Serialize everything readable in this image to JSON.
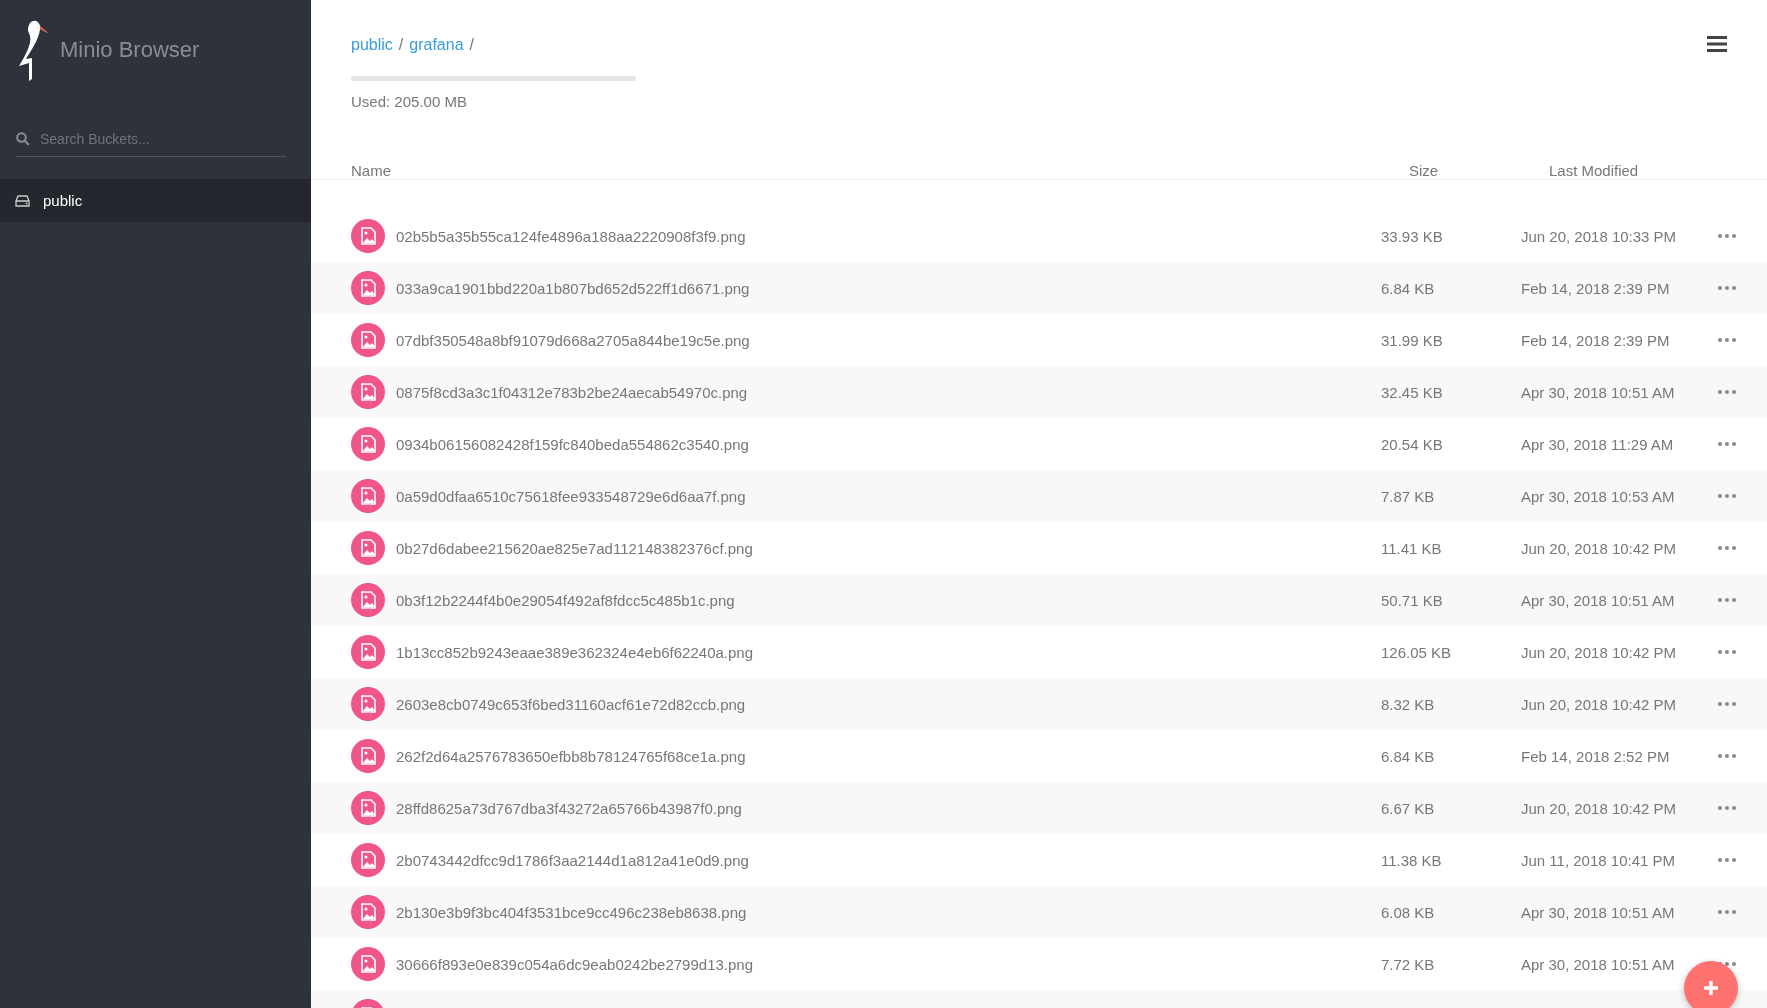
{
  "sidebar": {
    "title": "Minio Browser",
    "search": {
      "placeholder": "Search Buckets..."
    },
    "buckets": [
      {
        "name": "public",
        "selected": true
      }
    ]
  },
  "breadcrumb": [
    {
      "text": "public",
      "separator": "/"
    },
    {
      "text": "grafana",
      "separator": "/"
    }
  ],
  "usage": {
    "text": "Used: 205.00 MB"
  },
  "table": {
    "columns": [
      "Name",
      "Size",
      "Last Modified"
    ],
    "rows": [
      {
        "name": "02b5b5a35b55ca124fe4896a188aa2220908f3f9.png",
        "size": "33.93 KB",
        "modified": "Jun 20, 2018 10:33 PM"
      },
      {
        "name": "033a9ca1901bbd220a1b807bd652d522ff1d6671.png",
        "size": "6.84 KB",
        "modified": "Feb 14, 2018 2:39 PM"
      },
      {
        "name": "07dbf350548a8bf91079d668a2705a844be19c5e.png",
        "size": "31.99 KB",
        "modified": "Feb 14, 2018 2:39 PM"
      },
      {
        "name": "0875f8cd3a3c1f04312e783b2be24aecab54970c.png",
        "size": "32.45 KB",
        "modified": "Apr 30, 2018 10:51 AM"
      },
      {
        "name": "0934b06156082428f159fc840beda554862c3540.png",
        "size": "20.54 KB",
        "modified": "Apr 30, 2018 11:29 AM"
      },
      {
        "name": "0a59d0dfaa6510c75618fee933548729e6d6aa7f.png",
        "size": "7.87 KB",
        "modified": "Apr 30, 2018 10:53 AM"
      },
      {
        "name": "0b27d6dabee215620ae825e7ad112148382376cf.png",
        "size": "11.41 KB",
        "modified": "Jun 20, 2018 10:42 PM"
      },
      {
        "name": "0b3f12b2244f4b0e29054f492af8fdcc5c485b1c.png",
        "size": "50.71 KB",
        "modified": "Apr 30, 2018 10:51 AM"
      },
      {
        "name": "1b13cc852b9243eaae389e362324e4eb6f62240a.png",
        "size": "126.05 KB",
        "modified": "Jun 20, 2018 10:42 PM"
      },
      {
        "name": "2603e8cb0749c653f6bed31160acf61e72d82ccb.png",
        "size": "8.32 KB",
        "modified": "Jun 20, 2018 10:42 PM"
      },
      {
        "name": "262f2d64a2576783650efbb8b78124765f68ce1a.png",
        "size": "6.84 KB",
        "modified": "Feb 14, 2018 2:52 PM"
      },
      {
        "name": "28ffd8625a73d767dba3f43272a65766b43987f0.png",
        "size": "6.67 KB",
        "modified": "Jun 20, 2018 10:42 PM"
      },
      {
        "name": "2b0743442dfcc9d1786f3aa2144d1a812a41e0d9.png",
        "size": "11.38 KB",
        "modified": "Jun 11, 2018 10:41 PM"
      },
      {
        "name": "2b130e3b9f3bc404f3531bce9cc496c238eb8638.png",
        "size": "6.08 KB",
        "modified": "Apr 30, 2018 10:51 AM"
      },
      {
        "name": "30666f893e0e839c054a6dc9eab0242be2799d13.png",
        "size": "7.72 KB",
        "modified": "Apr 30, 2018 10:51 AM"
      }
    ]
  }
}
